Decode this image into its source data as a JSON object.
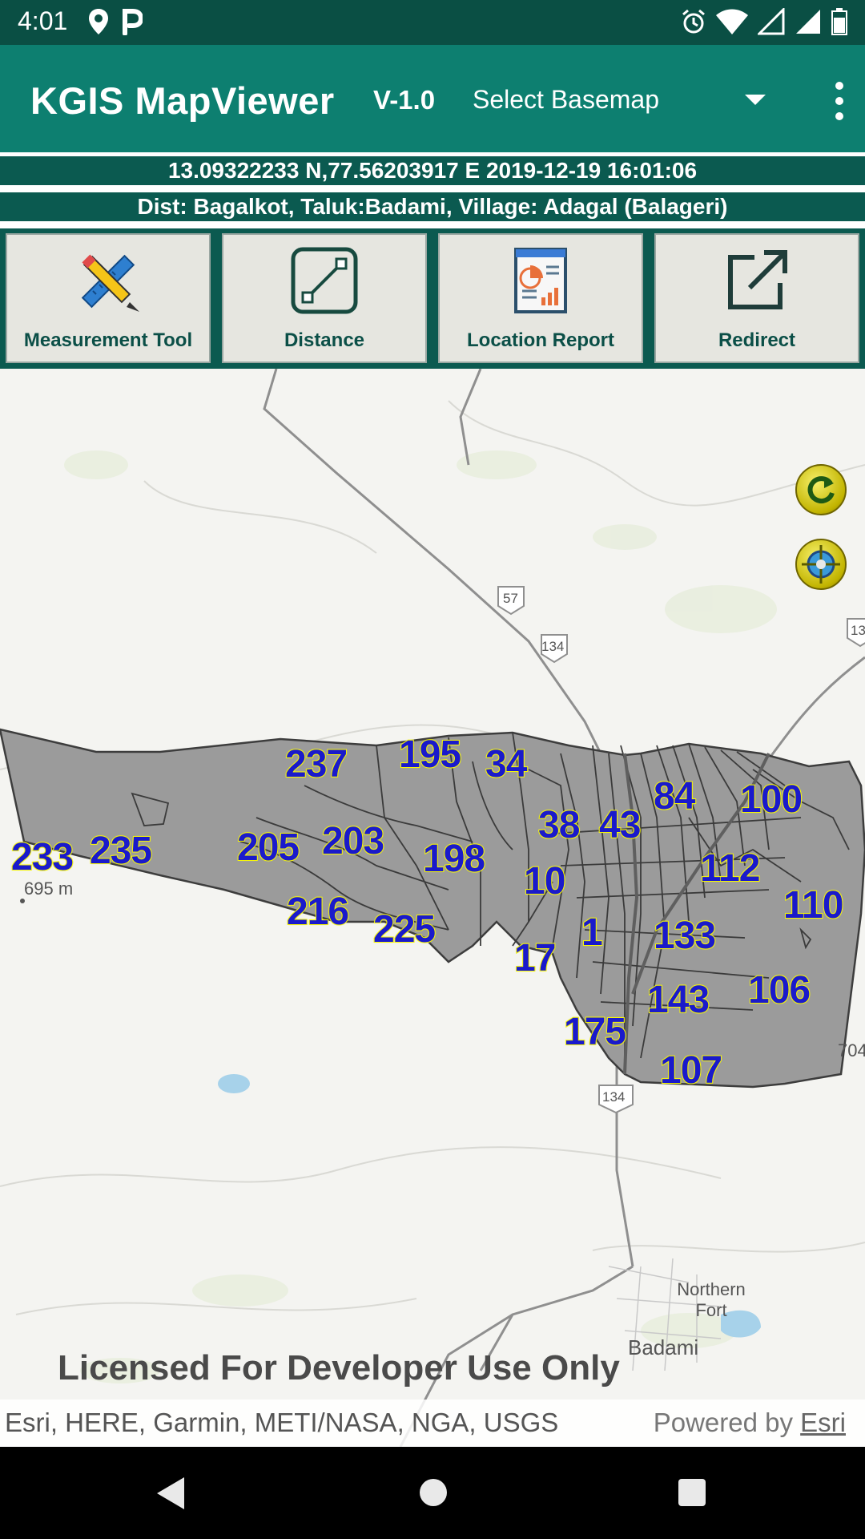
{
  "status_bar": {
    "time": "4:01",
    "left_icons": [
      "location-pin-icon",
      "parking-app-icon"
    ],
    "right_icons": [
      "alarm-icon",
      "wifi-icon",
      "signal-empty-icon",
      "signal-full-icon",
      "battery-icon"
    ]
  },
  "app_bar": {
    "title": "KGIS MapViewer",
    "version": "V-1.0",
    "basemap_select": "Select Basemap"
  },
  "info": {
    "coordinates": "13.09322233 N,77.56203917 E  2019-12-19 16:01:06",
    "location": "Dist: Bagalkot, Taluk:Badami,  Village: Adagal (Balageri)"
  },
  "tools": [
    {
      "label": "Measurement Tool",
      "icon": "pencil-ruler-icon"
    },
    {
      "label": "Distance",
      "icon": "distance-line-icon"
    },
    {
      "label": "Location Report",
      "icon": "report-chart-icon"
    },
    {
      "label": "Redirect",
      "icon": "external-link-icon"
    }
  ],
  "map": {
    "parcel_labels": [
      "237",
      "195",
      "34",
      "233",
      "235",
      "205",
      "203",
      "198",
      "216",
      "225",
      "38",
      "43",
      "84",
      "100",
      "10",
      "112",
      "110",
      "1",
      "17",
      "133",
      "106",
      "143",
      "175",
      "107"
    ],
    "place_labels": {
      "northern_fort": "Northern Fort",
      "badami": "Badami",
      "elevation_left": "695 m",
      "elevation_right": "704",
      "route_57": "57",
      "route_134_top": "134",
      "route_134_bottom": "134",
      "route_edge": "13"
    },
    "controls": [
      "refresh-icon",
      "gps-locate-icon"
    ],
    "license": "Licensed For Developer Use Only",
    "attribution": "Esri, HERE, Garmin, METI/NASA, NGA, USGS",
    "powered_by_prefix": "Powered by",
    "powered_by_link": "Esri"
  },
  "colors": {
    "status_bar": "#0a4f44",
    "app_bar": "#0d7f70",
    "info_bar": "#0b5a50",
    "parcel_fill": "#9b9b9b",
    "parcel_label_text": "#1a1acb",
    "parcel_label_outline": "#f2f20c"
  }
}
